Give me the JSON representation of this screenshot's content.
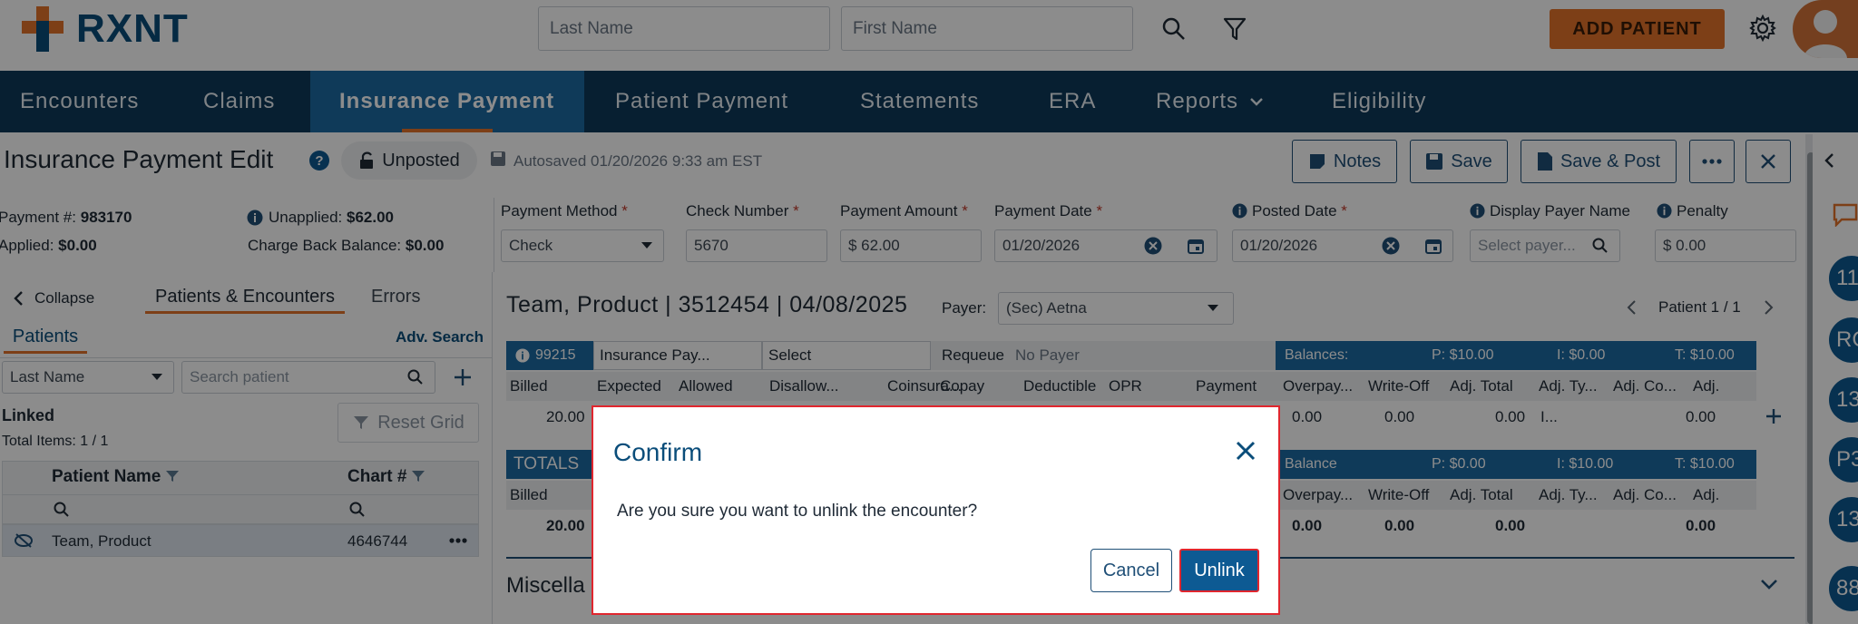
{
  "brand": {
    "name": "RXNT"
  },
  "topbar": {
    "last_name_placeholder": "Last Name",
    "first_name_placeholder": "First Name",
    "add_patient_label": "ADD PATIENT"
  },
  "nav": {
    "items": [
      {
        "label": "Encounters"
      },
      {
        "label": "Claims"
      },
      {
        "label": "Insurance Payment"
      },
      {
        "label": "Patient Payment"
      },
      {
        "label": "Statements"
      },
      {
        "label": "ERA"
      },
      {
        "label": "Reports"
      },
      {
        "label": "Eligibility"
      }
    ]
  },
  "page": {
    "title": "Insurance Payment Edit",
    "status": "Unposted",
    "autosaved": "Autosaved 01/20/2026 9:33 am EST",
    "buttons": {
      "notes": "Notes",
      "save": "Save",
      "save_post": "Save & Post"
    }
  },
  "payment_info": {
    "payment_num_label": "Payment #:",
    "payment_num_value": "983170",
    "applied_label": "Applied:",
    "applied_value": "$0.00",
    "unapplied_label": "Unapplied:",
    "unapplied_value": "$62.00",
    "chargeback_label": "Charge Back Balance:",
    "chargeback_value": "$0.00"
  },
  "fields": {
    "payment_method_label": "Payment Method",
    "payment_method_value": "Check",
    "check_number_label": "Check Number",
    "check_number_value": "5670",
    "payment_amount_label": "Payment Amount",
    "payment_amount_value": "$ 62.00",
    "payment_date_label": "Payment Date",
    "payment_date_value": "01/20/2026",
    "posted_date_label": "Posted Date",
    "posted_date_value": "01/20/2026",
    "display_payer_label": "Display Payer Name",
    "display_payer_placeholder": "Select payer...",
    "penalty_label": "Penalty",
    "penalty_value": "$ 0.00"
  },
  "left_panel": {
    "collapse_label": "Collapse",
    "tab_patients_encounters": "Patients & Encounters",
    "tab_errors": "Errors",
    "patients_tab": "Patients",
    "adv_search": "Adv. Search",
    "search_by": "Last Name",
    "search_placeholder": "Search patient",
    "linked_label": "Linked",
    "reset_grid": "Reset Grid",
    "total_items": "Total Items: 1 / 1",
    "col_patient_name": "Patient Name",
    "col_chart": "Chart #",
    "rows": [
      {
        "name": "Team, Product",
        "chart": "4646744"
      }
    ]
  },
  "encounter": {
    "title": "Team, Product | 3512454 | 04/08/2025",
    "payer_label": "Payer:",
    "payer_value": "(Sec) Aetna",
    "pager": "Patient 1 / 1",
    "code": "99215",
    "insurance_pay": "Insurance Pay...",
    "select": "Select",
    "requeue": "Requeue",
    "no_payer": "No Payer",
    "balances_label": "Balances:",
    "bal_p": "P: $10.00",
    "bal_i": "I: $0.00",
    "bal_t": "T: $10.00",
    "headers": [
      "Billed",
      "Expected",
      "Allowed",
      "Disallow...",
      "Coinsura...",
      "Copay",
      "Deductible",
      "OPR",
      "Payment",
      "Overpay...",
      "Write-Off",
      "Adj. Total",
      "Adj. Ty...",
      "Adj. Co...",
      "Adj."
    ],
    "billed_value": "20.00",
    "overpay_value": "0.00",
    "writeoff_value": "0.00",
    "adjtotal_value": "0.00",
    "adjtype_value": "I...",
    "adj_value": "0.00",
    "totals_label": "TOTALS",
    "totals_balance_label": "Balance",
    "totals_p": "P: $0.00",
    "totals_i": "I: $10.00",
    "totals_t": "T: $10.00",
    "totals_headers": [
      "Billed",
      "Overpay...",
      "Write-Off",
      "Adj. Total",
      "Adj. Ty...",
      "Adj. Co...",
      "Adj."
    ],
    "totals_billed": "20.00",
    "totals_overpay": "0.00",
    "totals_writeoff": "0.00",
    "totals_adjtotal": "0.00",
    "totals_adj": "0.00",
    "misc_label": "Miscella"
  },
  "sidebar_bubbles": [
    "11",
    "RC",
    "13",
    "P3",
    "13",
    "88"
  ],
  "modal": {
    "title": "Confirm",
    "message": "Are you sure you want to unlink the encounter?",
    "cancel_label": "Cancel",
    "unlink_label": "Unlink"
  },
  "colors": {
    "brand_blue": "#0a4d7a",
    "nav_bg": "#0e3a5a",
    "nav_active": "#1c6aa3",
    "accent_orange": "#e4742b",
    "danger_red": "#e0262e"
  }
}
